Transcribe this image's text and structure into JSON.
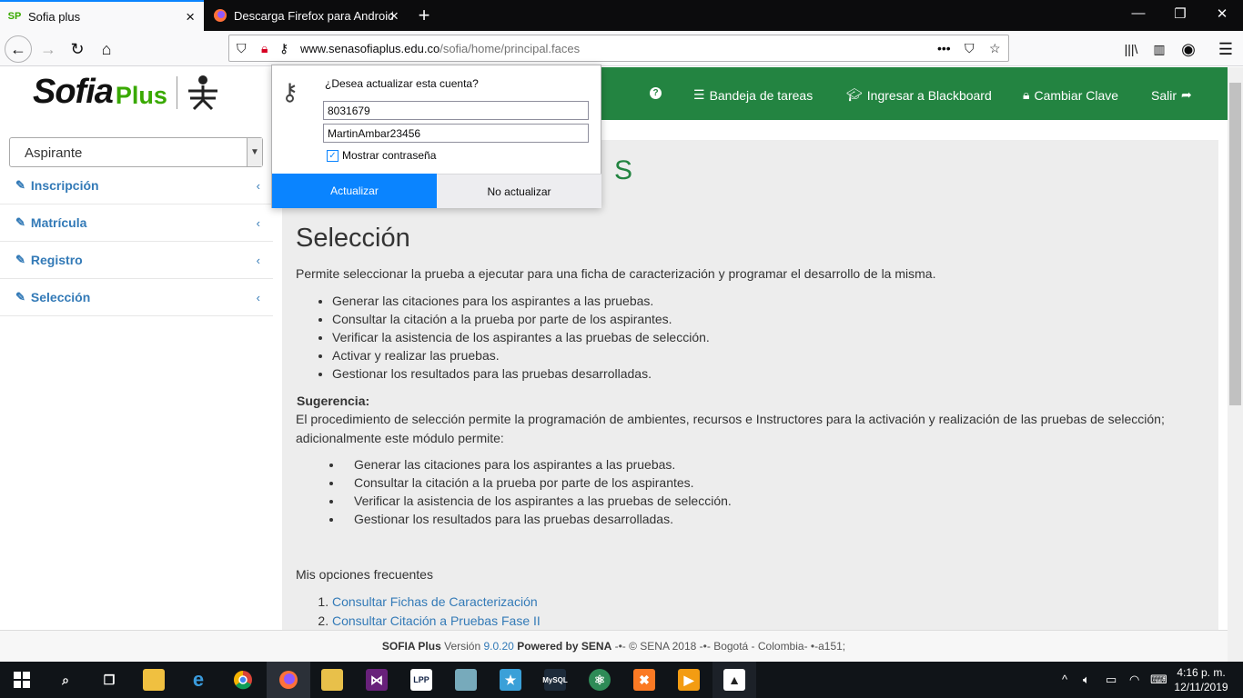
{
  "browser": {
    "tabs": [
      {
        "label": "Sofia plus",
        "favicon": "SP"
      },
      {
        "label": "Descarga Firefox para Android",
        "favicon": "firefox-icon"
      }
    ],
    "url_host": "www.senasofiaplus.edu.co",
    "url_path": "/sofia/home/principal.faces",
    "accent": "#0a84ff"
  },
  "logo": {
    "sofia": "Sofia",
    "plus": "Plus"
  },
  "topnav": {
    "help": "?",
    "inbox": "Bandeja de tareas",
    "blackboard": "Ingresar a Blackboard",
    "password": "Cambiar Clave",
    "logout": "Salir"
  },
  "sidebar": {
    "role": "Aspirante",
    "items": [
      {
        "label": "Inscripción"
      },
      {
        "label": "Matrícula"
      },
      {
        "label": "Registro"
      },
      {
        "label": "Selección"
      }
    ]
  },
  "main": {
    "ghost_heading": "S",
    "title": "Selección",
    "intro": "Permite seleccionar la prueba a ejecutar para una ficha de caracterización y programar el desarrollo de la misma.",
    "list1": [
      "Generar las citaciones para los aspirantes a las pruebas.",
      "Consultar la citación a la prueba por parte de los aspirantes.",
      "Verificar la asistencia de los aspirantes a las pruebas de selección.",
      "Activar y realizar las pruebas.",
      "Gestionar los resultados para las pruebas desarrolladas."
    ],
    "suggest_label": "Sugerencia:",
    "suggest_text": "El procedimiento de selección permite la programación de ambientes, recursos e Instructores para la activación y realización de las pruebas de selección; adicionalmente este módulo permite:",
    "list2": [
      "Generar las citaciones para los aspirantes a las pruebas.",
      "Consultar la citación a la prueba por parte de los aspirantes.",
      "Verificar la asistencia de los aspirantes a las pruebas de selección.",
      "Gestionar los resultados para las pruebas desarrolladas."
    ],
    "frequent_label": "Mis opciones frecuentes",
    "frequent": [
      "Consultar Fichas de Caracterización",
      "Consultar Citación a Pruebas Fase II"
    ]
  },
  "footer": {
    "brand": "SOFIA Plus",
    "version_label": "Versión",
    "version": "9.0.20",
    "powered": "Powered by SENA",
    "rest": "-•- © SENA 2018 -•- Bogotá - Colombia- •-a151;"
  },
  "popup": {
    "question": "¿Desea actualizar esta cuenta?",
    "username": "8031679",
    "password": "MartinAmbar23456",
    "show_password": "Mostrar contraseña",
    "update": "Actualizar",
    "no_update": "No actualizar"
  },
  "taskbar": {
    "time": "4:16 p. m.",
    "date": "12/11/2019"
  }
}
